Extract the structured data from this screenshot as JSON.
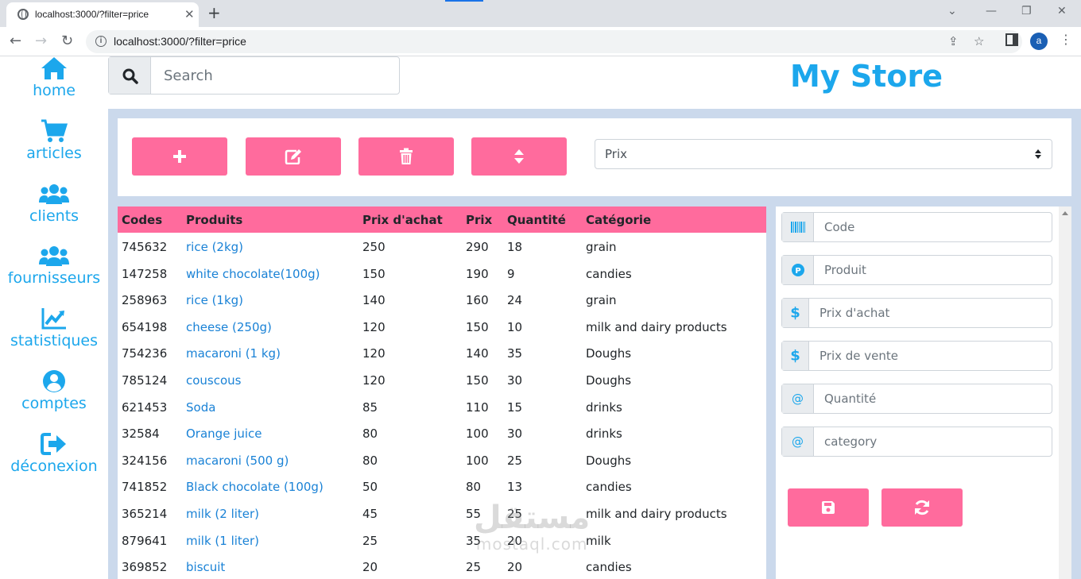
{
  "browser": {
    "tab_title": "localhost:3000/?filter=price",
    "url": "localhost:3000/?filter=price",
    "profile_initial": "a"
  },
  "sidebar": {
    "items": [
      {
        "label": "home",
        "icon": "home-icon"
      },
      {
        "label": "articles",
        "icon": "shopping-cart-icon"
      },
      {
        "label": "clients",
        "icon": "users-icon"
      },
      {
        "label": "fournisseurs",
        "icon": "users-icon"
      },
      {
        "label": "statistiques",
        "icon": "chart-line-icon"
      },
      {
        "label": "comptes",
        "icon": "user-circle-icon"
      },
      {
        "label": "déconexion",
        "icon": "sign-out-icon"
      }
    ]
  },
  "search": {
    "placeholder": "Search"
  },
  "header": {
    "title": "My Store"
  },
  "actions": {
    "buttons": [
      {
        "name": "add-button",
        "icon": "plus-icon"
      },
      {
        "name": "edit-button",
        "icon": "edit-icon"
      },
      {
        "name": "delete-button",
        "icon": "trash-icon"
      },
      {
        "name": "sort-button",
        "icon": "sort-icon"
      }
    ],
    "filter_selected": "Prix"
  },
  "table": {
    "columns": [
      "Codes",
      "Produits",
      "Prix d'achat",
      "Prix",
      "Quantité",
      "Catégorie"
    ],
    "rows": [
      [
        "745632",
        "rice (2kg)",
        "250",
        "290",
        "18",
        "grain"
      ],
      [
        "147258",
        "white chocolate(100g)",
        "150",
        "190",
        "9",
        "candies"
      ],
      [
        "258963",
        "rice (1kg)",
        "140",
        "160",
        "24",
        "grain"
      ],
      [
        "654198",
        "cheese (250g)",
        "120",
        "150",
        "10",
        "milk and dairy products"
      ],
      [
        "754236",
        "macaroni (1 kg)",
        "120",
        "140",
        "35",
        "Doughs"
      ],
      [
        "785124",
        "couscous",
        "120",
        "150",
        "30",
        "Doughs"
      ],
      [
        "621453",
        "Soda",
        "85",
        "110",
        "15",
        "drinks"
      ],
      [
        "32584",
        "Orange juice",
        "80",
        "100",
        "30",
        "drinks"
      ],
      [
        "324156",
        "macaroni (500 g)",
        "80",
        "100",
        "25",
        "Doughs"
      ],
      [
        "741852",
        "Black chocolate (100g)",
        "50",
        "80",
        "13",
        "candies"
      ],
      [
        "365214",
        "milk (2 liter)",
        "45",
        "55",
        "25",
        "milk and dairy products"
      ],
      [
        "879641",
        "milk (1 liter)",
        "25",
        "35",
        "20",
        "milk"
      ],
      [
        "369852",
        "biscuit",
        "20",
        "25",
        "20",
        "candies"
      ]
    ]
  },
  "form": {
    "fields": [
      {
        "placeholder": "Code",
        "icon": "barcode-icon"
      },
      {
        "placeholder": "Produit",
        "icon": "product-p-icon"
      },
      {
        "placeholder": "Prix d'achat",
        "icon": "dollar-icon"
      },
      {
        "placeholder": "Prix de vente",
        "icon": "dollar-icon"
      },
      {
        "placeholder": "Quantité",
        "icon": "at-icon"
      },
      {
        "placeholder": "category",
        "icon": "at-icon"
      }
    ]
  },
  "watermark": {
    "arabic": "مستقل",
    "latin": "mostaql.com"
  },
  "colors": {
    "accent": "#ff6b9d",
    "brand": "#1ca7ec",
    "link": "#1a82d6",
    "background": "#cbd9ec"
  }
}
